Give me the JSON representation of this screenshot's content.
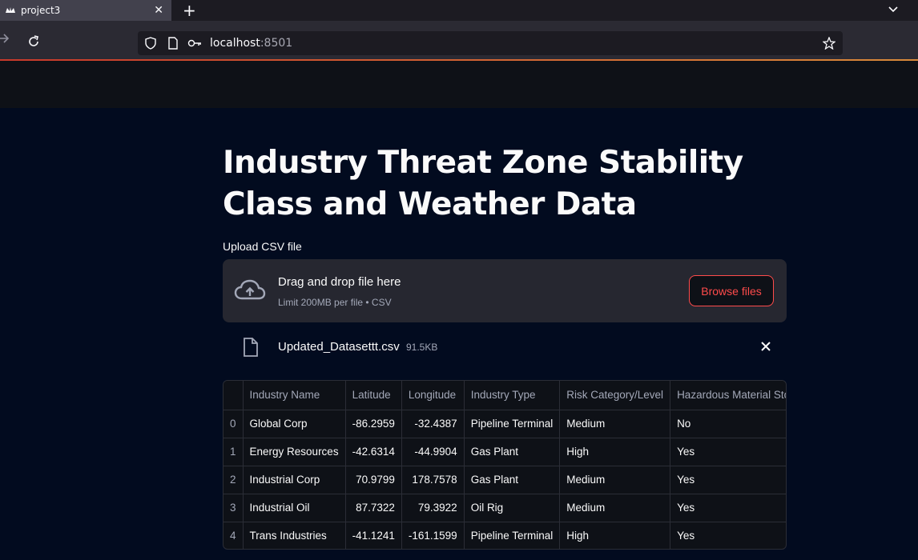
{
  "browser": {
    "tab_title": "project3",
    "url_host": "localhost",
    "url_port": ":8501"
  },
  "page": {
    "title": "Industry Threat Zone Stability Class and Weather Data",
    "upload_label": "Upload CSV file",
    "dropzone": {
      "main_text": "Drag and drop file here",
      "sub_text": "Limit 200MB per file • CSV",
      "browse_label": "Browse files"
    },
    "uploaded_file": {
      "name": "Updated_Datasettt.csv",
      "size": "91.5KB"
    }
  },
  "table": {
    "columns": [
      "",
      "Industry Name",
      "Latitude",
      "Longitude",
      "Industry Type",
      "Risk Category/Level",
      "Hazardous Material Sto"
    ],
    "rows": [
      [
        "0",
        "Global Corp",
        "-86.2959",
        "-32.4387",
        "Pipeline Terminal",
        "Medium",
        "No"
      ],
      [
        "1",
        "Energy Resources",
        "-42.6314",
        "-44.9904",
        "Gas Plant",
        "High",
        "Yes"
      ],
      [
        "2",
        "Industrial Corp",
        "70.9799",
        "178.7578",
        "Gas Plant",
        "Medium",
        "Yes"
      ],
      [
        "3",
        "Industrial Oil",
        "87.7322",
        "79.3922",
        "Oil Rig",
        "Medium",
        "Yes"
      ],
      [
        "4",
        "Trans Industries",
        "-41.1241",
        "-161.1599",
        "Pipeline Terminal",
        "High",
        "Yes"
      ]
    ]
  },
  "colors": {
    "accent": "#ff4b4b",
    "background": "#020b1f"
  }
}
